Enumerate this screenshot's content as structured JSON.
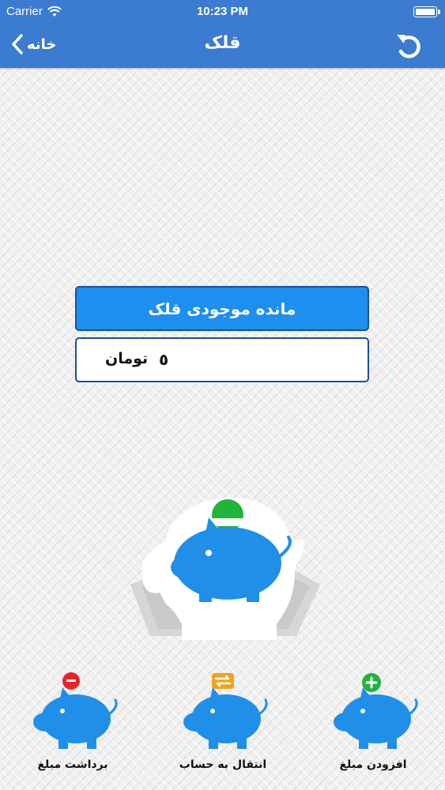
{
  "status_bar": {
    "carrier": "Carrier",
    "time": "10:23 PM"
  },
  "nav": {
    "title": "قلک",
    "back_label": "خانه"
  },
  "balance": {
    "header": "مانده موجودی قلک",
    "amount": "٥",
    "unit": "تومان"
  },
  "actions": {
    "withdraw": "برداشت مبلغ",
    "transfer": "انتقال به حساب",
    "add": "افزودن مبلغ"
  },
  "colors": {
    "nav": "#3b7bd0",
    "accent": "#1c8ff0",
    "border": "#1a4fa0",
    "coin_green": "#1fb43a",
    "coin_red": "#e8242a",
    "coin_orange": "#f2a21a"
  },
  "icons": [
    "wifi-icon",
    "battery-icon",
    "chevron-left-icon",
    "refresh-icon",
    "piggy-bank-icon",
    "minus-icon",
    "transfer-icon",
    "plus-icon"
  ]
}
